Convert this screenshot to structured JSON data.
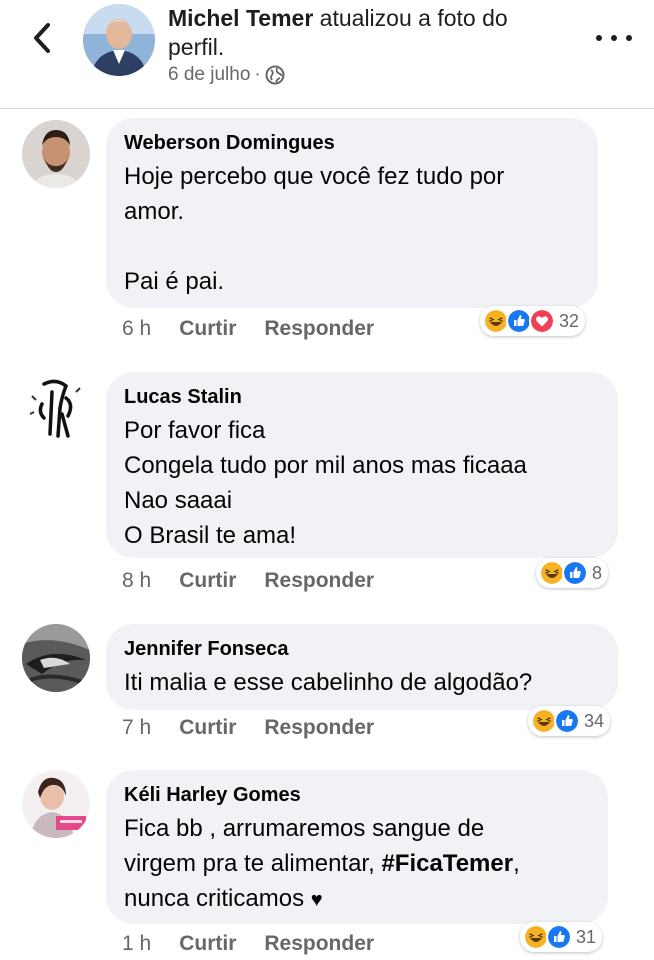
{
  "header": {
    "author": "Michel Temer",
    "action": " atualizou a foto do perfil.",
    "date": "6 de julho",
    "separator": "·"
  },
  "colors": {
    "bubble": "#f0f2f5",
    "meta_text": "#65676b",
    "like_blue": "#1877f2",
    "love_red": "#f33e58",
    "haha_yellow": "#f7b125"
  },
  "comments": [
    {
      "author": "Weberson Domingues",
      "text": "Hoje percebo que você fez tudo por\namor.\n\nPai é pai.",
      "time": "6 h",
      "like": "Curtir",
      "reply": "Responder",
      "reactions": [
        "haha",
        "like",
        "love"
      ],
      "reaction_count": "32"
    },
    {
      "author": "Lucas Stalin",
      "text": "Por favor fica\nCongela tudo por mil anos mas ficaaa\nNao saaai\nO Brasil te ama!",
      "time": "8 h",
      "like": "Curtir",
      "reply": "Responder",
      "reactions": [
        "haha",
        "like"
      ],
      "reaction_count": "8"
    },
    {
      "author": "Jennifer Fonseca",
      "text": "Iti malia e esse cabelinho de algodão?",
      "time": "7 h",
      "like": "Curtir",
      "reply": "Responder",
      "reactions": [
        "haha",
        "like"
      ],
      "reaction_count": "34"
    },
    {
      "author": "Kéli Harley Gomes",
      "text_before": "Fica bb , arrumaremos sangue de\nvirgem pra te alimentar, ",
      "hashtag": "#FicaTemer",
      "text_after": ",\nnunca criticamos ",
      "heart": "♥",
      "time": "1 h",
      "like": "Curtir",
      "reply": "Responder",
      "reactions": [
        "haha",
        "like"
      ],
      "reaction_count": "31"
    }
  ]
}
